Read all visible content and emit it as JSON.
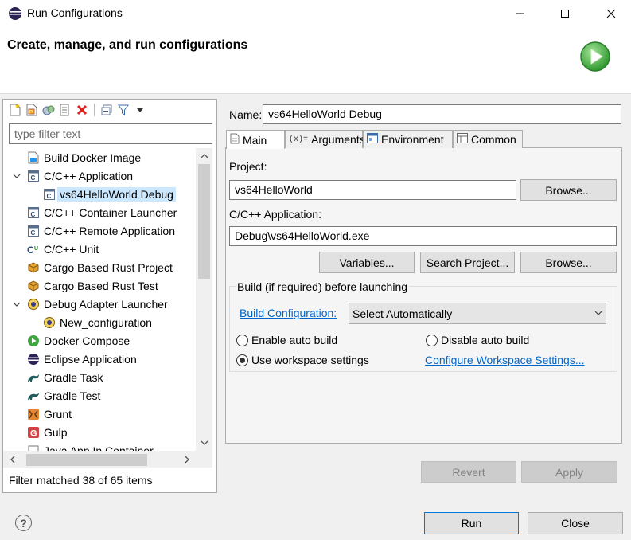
{
  "window": {
    "title": "Run Configurations",
    "controls": {
      "minimize": "—",
      "maximize": "☐",
      "close": "✕"
    }
  },
  "header": {
    "title": "Create, manage, and run configurations",
    "icon": "run-icon"
  },
  "left": {
    "toolbar": [
      "new-config-icon",
      "new-prototype-icon",
      "duplicate-icon",
      "export-icon",
      "delete-icon",
      "collapse-all-icon",
      "filter-icon",
      "view-menu-icon"
    ],
    "filter": {
      "placeholder": "type filter text",
      "value": ""
    },
    "tree": [
      {
        "label": "Build Docker Image",
        "level": 0,
        "twisty": "",
        "icon": "docker-build-icon"
      },
      {
        "label": "C/C++ Application",
        "level": 0,
        "twisty": "expanded",
        "icon": "c-app-icon"
      },
      {
        "label": "vs64HelloWorld Debug",
        "level": 1,
        "twisty": "",
        "icon": "c-app-icon",
        "selected": true
      },
      {
        "label": "C/C++ Container Launcher",
        "level": 0,
        "twisty": "",
        "icon": "c-app-icon"
      },
      {
        "label": "C/C++ Remote Application",
        "level": 0,
        "twisty": "",
        "icon": "c-app-icon"
      },
      {
        "label": "C/C++ Unit",
        "level": 0,
        "twisty": "",
        "icon": "c-unit-icon"
      },
      {
        "label": "Cargo Based Rust Project",
        "level": 0,
        "twisty": "",
        "icon": "cargo-icon"
      },
      {
        "label": "Cargo Based Rust Test",
        "level": 0,
        "twisty": "",
        "icon": "cargo-icon"
      },
      {
        "label": "Debug Adapter Launcher",
        "level": 0,
        "twisty": "expanded",
        "icon": "debug-adapter-icon"
      },
      {
        "label": "New_configuration",
        "level": 1,
        "twisty": "",
        "icon": "debug-adapter-icon"
      },
      {
        "label": "Docker Compose",
        "level": 0,
        "twisty": "",
        "icon": "docker-compose-icon"
      },
      {
        "label": "Eclipse Application",
        "level": 0,
        "twisty": "",
        "icon": "eclipse-icon"
      },
      {
        "label": "Gradle Task",
        "level": 0,
        "twisty": "",
        "icon": "gradle-icon"
      },
      {
        "label": "Gradle Test",
        "level": 0,
        "twisty": "",
        "icon": "gradle-icon"
      },
      {
        "label": "Grunt",
        "level": 0,
        "twisty": "",
        "icon": "grunt-icon"
      },
      {
        "label": "Gulp",
        "level": 0,
        "twisty": "",
        "icon": "gulp-icon"
      },
      {
        "label": "Java App In Container",
        "level": 0,
        "twisty": "",
        "icon": "java-container-icon"
      }
    ],
    "status": "Filter matched 38 of 65 items"
  },
  "right": {
    "name_label": "Name:",
    "name_value": "vs64HelloWorld Debug",
    "tabs": [
      {
        "label": "Main",
        "icon": "main-tab-icon",
        "active": true
      },
      {
        "label": "Arguments",
        "icon": "arguments-tab-icon",
        "active": false
      },
      {
        "label": "Environment",
        "icon": "environment-tab-icon",
        "active": false
      },
      {
        "label": "Common",
        "icon": "common-tab-icon",
        "active": false
      }
    ],
    "project_label": "Project:",
    "project_value": "vs64HelloWorld",
    "browse_label": "Browse...",
    "application_label": "C/C++ Application:",
    "application_value": "Debug\\vs64HelloWorld.exe",
    "variables_label": "Variables...",
    "search_project_label": "Search Project...",
    "browse2_label": "Browse...",
    "build_group_label": "Build (if required) before launching",
    "build_config_link": "Build Configuration:",
    "build_config_value": "Select Automatically",
    "radios": {
      "enable_auto": {
        "label": "Enable auto build",
        "checked": false
      },
      "disable_auto": {
        "label": "Disable auto build",
        "checked": false
      },
      "use_workspace": {
        "label": "Use workspace settings",
        "checked": true
      }
    },
    "configure_link": "Configure Workspace Settings...",
    "revert_label": "Revert",
    "apply_label": "Apply"
  },
  "footer": {
    "help": "?",
    "run_label": "Run",
    "close_label": "Close"
  },
  "colors": {
    "accent": "#0078d7",
    "link": "#0066cc",
    "selection": "#cce8ff",
    "run_icon": "#3fa53f"
  }
}
